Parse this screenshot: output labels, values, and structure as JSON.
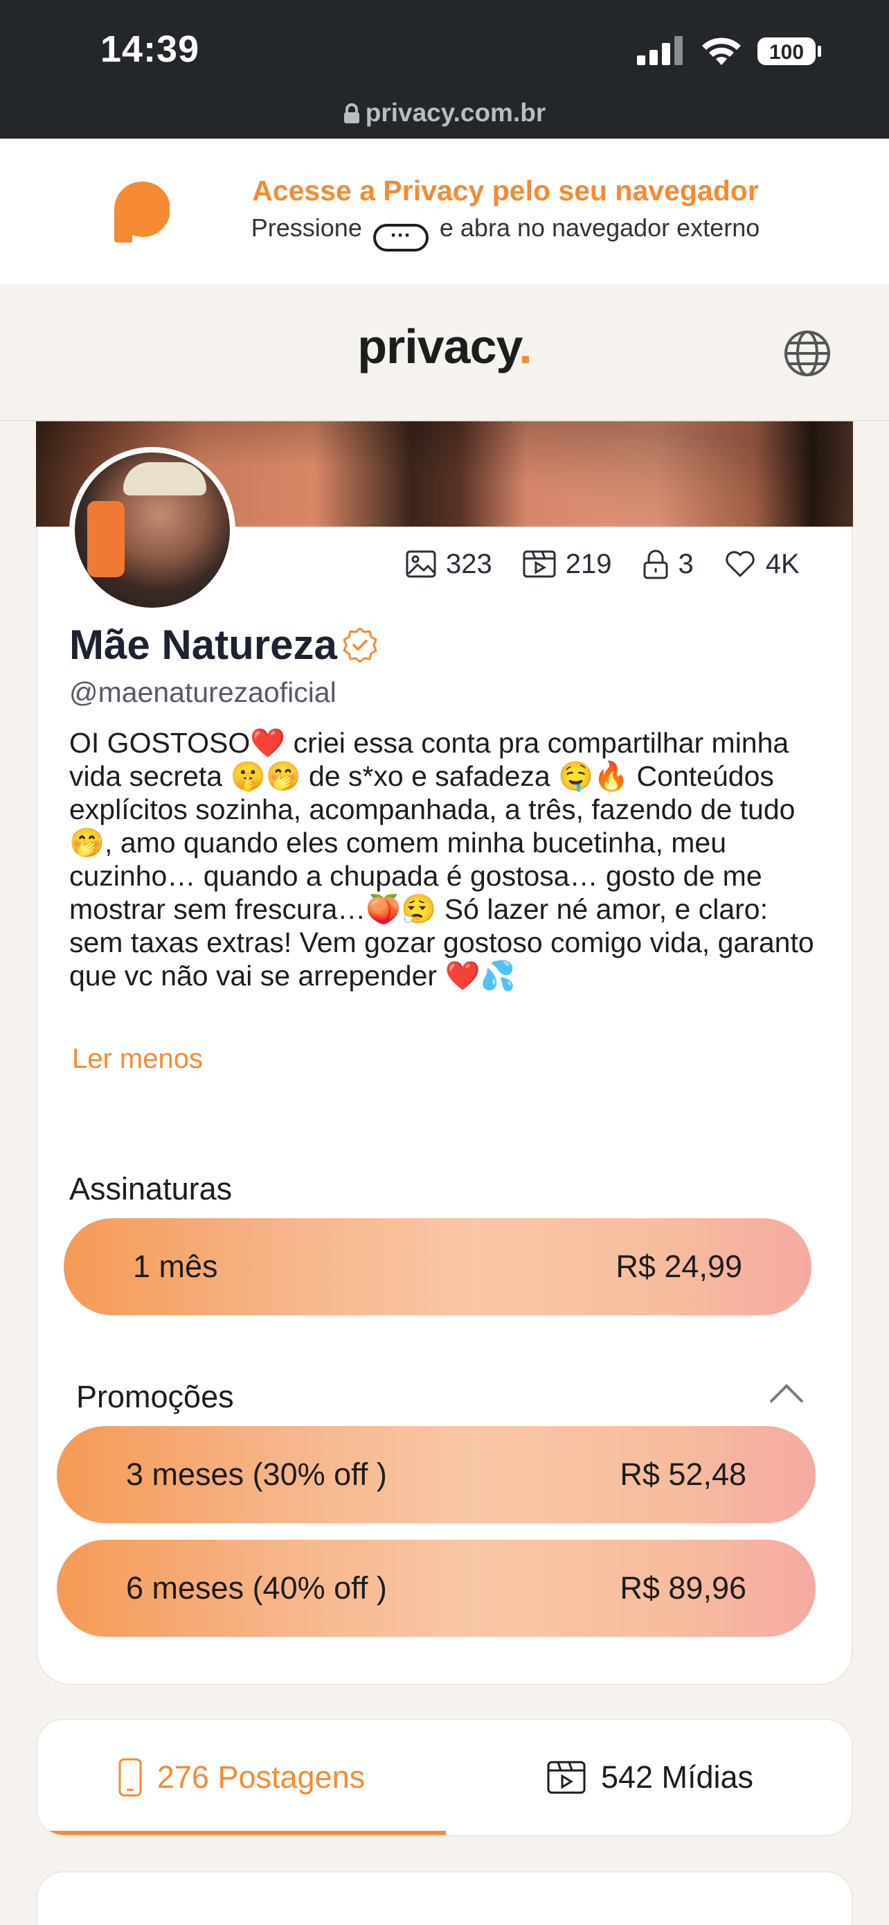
{
  "status_bar": {
    "time": "14:39",
    "battery": "100"
  },
  "browser": {
    "url": "privacy.com.br"
  },
  "banner": {
    "title": "Acesse a Privacy pelo seu navegador",
    "sub_before": "Pressione",
    "sub_pill": "···",
    "sub_after": "e abra no navegador externo"
  },
  "header": {
    "brand": "privacy",
    "brand_dot": "."
  },
  "profile": {
    "stats": {
      "images": "323",
      "videos": "219",
      "locked": "3",
      "likes": "4K"
    },
    "name": "Mãe Natureza",
    "handle": "@maenaturezaoficial",
    "bio": "OI GOSTOSO❤️ criei essa conta pra compartilhar minha vida secreta 🤫🤭 de s*xo e safadeza 🤤🔥 Conteúdos explícitos sozinha, acompanhada, a três, fazendo de tudo🤭, amo quando eles comem minha bucetinha, meu cuzinho… quando a chupada é gostosa… gosto de me mostrar sem frescura…🍑😮‍💨 Só lazer né amor, e claro: sem taxas extras! Vem gozar gostoso comigo vida, garanto que vc não vai se arrepender ❤️💦",
    "read_less": "Ler menos"
  },
  "subscriptions": {
    "title": "Assinaturas",
    "plan": {
      "label": "1 mês",
      "price": "R$ 24,99"
    }
  },
  "promotions": {
    "title": "Promoções",
    "items": [
      {
        "label": "3 meses (30% off )",
        "price": "R$ 52,48"
      },
      {
        "label": "6 meses (40% off )",
        "price": "R$ 89,96"
      }
    ]
  },
  "tabs": [
    {
      "label": "276 Postagens",
      "active": true
    },
    {
      "label": "542 Mídias",
      "active": false
    }
  ],
  "colors": {
    "accent": "#f58a32",
    "status_bar": "#23262b",
    "text": "#1c1c1c"
  }
}
